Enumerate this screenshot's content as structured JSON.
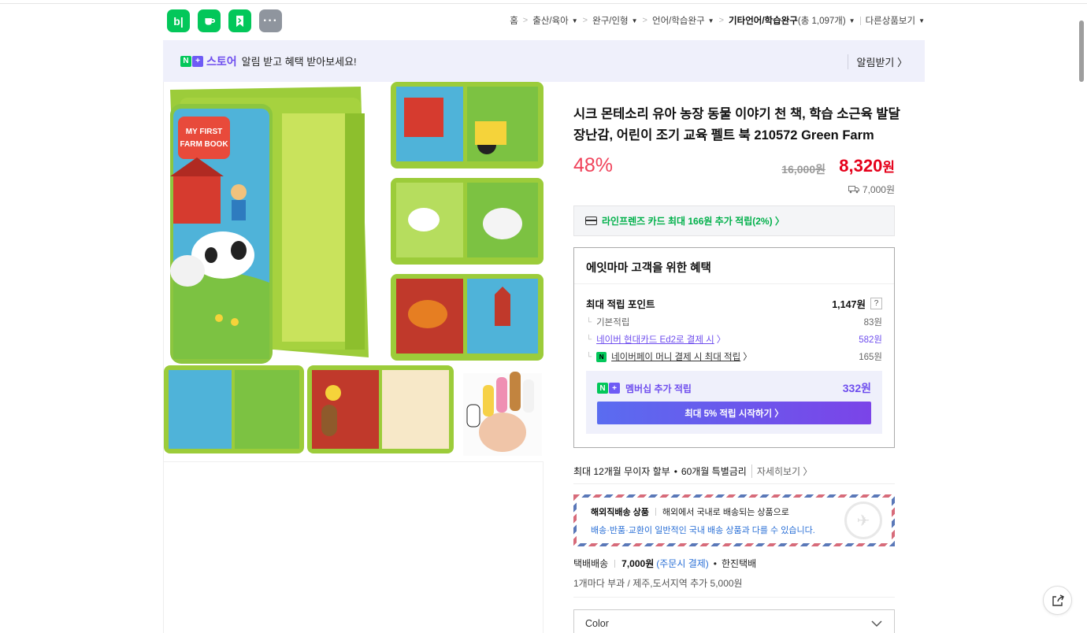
{
  "header": {
    "app_icons": [
      {
        "name": "blog-app-icon",
        "glyph": "b|"
      },
      {
        "name": "cafe-app-icon",
        "glyph": "☕"
      },
      {
        "name": "bookmark-app-icon",
        "glyph": "⚑"
      },
      {
        "name": "more-apps-icon",
        "glyph": "···"
      }
    ],
    "breadcrumb": {
      "home": "홈",
      "c1": "출산/육아",
      "c2": "완구/인형",
      "c3": "언어/학습완구",
      "c4": "기타언어/학습완구",
      "c4_count": "(총 1,097개)",
      "other": "다른상품보기"
    }
  },
  "store_banner": {
    "n": "N",
    "plus": "+",
    "store": "스토어",
    "text": "알림 받고 혜택 받아보세요!",
    "action": "알림받기 〉"
  },
  "product": {
    "image_text": "MY FIRST FARM BOOK",
    "title": "시크 몬테소리 유아 농장 동물 이야기 천 책, 학습 소근육 발달 장난감, 어린이 조기 교육 펠트 북 210572 Green Farm",
    "discount": "48%",
    "original_price": "16,000원",
    "sale_price_num": "8,320",
    "sale_price_unit": "원",
    "shipping_fee": "7,000원"
  },
  "card_promo": "라인프렌즈 카드 최대 166원 추가 적립(2%) 〉",
  "benefits": {
    "title": "에잇마마 고객을 위한 혜택",
    "max_points_label": "최대 적립 포인트",
    "max_points_value": "1,147원",
    "help": "?",
    "basic_label": "기본적립",
    "basic_value": "83원",
    "card_label": "네이버 현대카드 Ed2로 결제 시",
    "card_arrow": "〉",
    "card_value": "582원",
    "npay_badge": "N",
    "npay_label": "네이버페이 머니 결제 시 최대 적립",
    "npay_arrow": "〉",
    "npay_value": "165원",
    "member_n": "N",
    "member_plus": "+",
    "member_label": "멤버십 추가 적립",
    "member_value": "332원",
    "member_button": "최대 5% 적립 시작하기 〉"
  },
  "installment": {
    "text1": "최대 12개월 무이자 할부",
    "dot": "•",
    "text2": "60개월 특별금리",
    "more": "자세히보기 〉"
  },
  "overseas": {
    "label": "해외직배송 상품",
    "desc": "해외에서 국내로 배송되는 상품으로",
    "note": "배송·반품·교환이 일반적인 국내 배송 상품과 다를 수 있습니다.",
    "stamp_icon": "✈"
  },
  "delivery": {
    "type": "택배배송",
    "fee": "7,000원",
    "fee_note": "(주문시 결제)",
    "dot": "•",
    "carrier": "한진택배",
    "extra": "1개마다 부과 / 제주,도서지역 추가 5,000원"
  },
  "option": {
    "color_label": "Color"
  },
  "colors": {
    "naver_green": "#03c75a",
    "store_purple": "#6e4dee",
    "discount_red": "#f0425a",
    "price_red": "#e5001a"
  }
}
